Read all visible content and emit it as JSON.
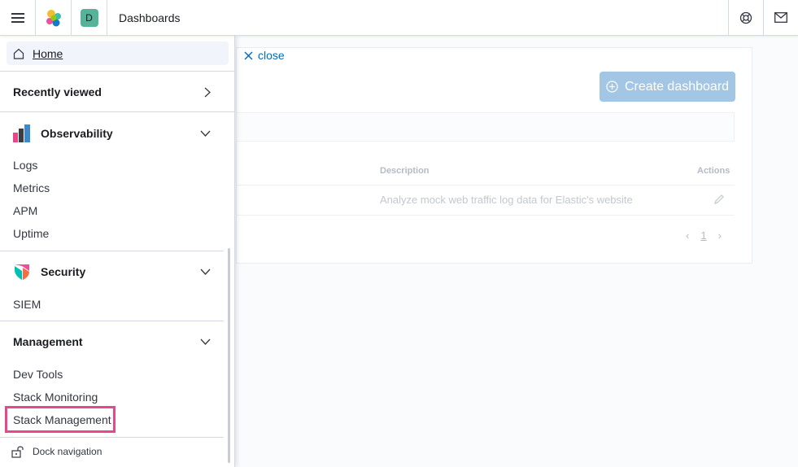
{
  "header": {
    "space_initial": "D",
    "title": "Dashboards",
    "menu_icon": "hamburger-icon",
    "logo_icon": "elastic-logo-icon",
    "help_icon": "help-lifebuoy-icon",
    "news_icon": "mail-icon"
  },
  "background": {
    "close_label": "close",
    "create_button": "Create dashboard",
    "col_description": "Description",
    "col_actions": "Actions",
    "row_description": "Analyze mock web traffic log data for Elastic's website",
    "page_number": "1"
  },
  "nav": {
    "home": "Home",
    "recently_viewed": "Recently viewed",
    "groups": [
      {
        "title": "Observability",
        "items": [
          "Logs",
          "Metrics",
          "APM",
          "Uptime"
        ]
      },
      {
        "title": "Security",
        "items": [
          "SIEM"
        ]
      },
      {
        "title": "Management",
        "items": [
          "Dev Tools",
          "Stack Monitoring",
          "Stack Management"
        ]
      }
    ],
    "dock": "Dock navigation"
  },
  "colors": {
    "accent": "#006bb8",
    "highlight": "#e8478b",
    "space_avatar": "#54b399"
  }
}
